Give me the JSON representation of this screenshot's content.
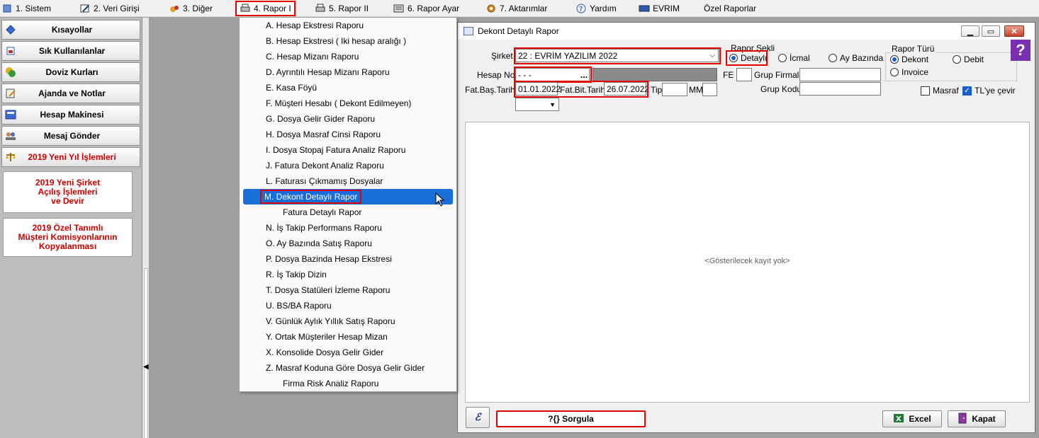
{
  "menubar": {
    "items": [
      {
        "label": "1.  Sistem",
        "icon": "system-icon"
      },
      {
        "label": "2.  Veri Girişi",
        "icon": "data-entry-icon"
      },
      {
        "label": "3.  Diğer",
        "icon": "other-icon"
      },
      {
        "label": "4.  Rapor I",
        "icon": "printer-icon"
      },
      {
        "label": "5.   Rapor II",
        "icon": "printer-icon"
      },
      {
        "label": "6.   Rapor Ayar",
        "icon": "report-settings-icon"
      },
      {
        "label": "7.  Aktarımlar",
        "icon": "transfer-icon"
      },
      {
        "label": "Yardım",
        "icon": "help-icon"
      },
      {
        "label": "EVRIM",
        "icon": "evrim-icon"
      },
      {
        "label": "Özel Raporlar",
        "icon": ""
      }
    ]
  },
  "sidebar": {
    "buttons": [
      {
        "label": "Kısayollar"
      },
      {
        "label": "Sık Kullanılanlar"
      },
      {
        "label": "Doviz Kurları"
      },
      {
        "label": "Ajanda ve Notlar"
      },
      {
        "label": "Hesap Makinesi"
      },
      {
        "label": "Mesaj Gönder"
      },
      {
        "label": "2019 Yeni Yıl İşlemleri"
      }
    ],
    "big_buttons": [
      {
        "label": "2019 Yeni Şirket\nAçılış İşlemleri\nve Devir"
      },
      {
        "label": "2019 Özel Tanımlı\nMüşteri Komisyonlarının\nKopyalanması"
      }
    ]
  },
  "dropdown": {
    "items": [
      "A.  Hesap Ekstresi Raporu",
      "B.  Hesap Ekstresi ( Iki hesap aralığı )",
      "C.  Hesap Mizanı Raporu",
      "D.  Ayrıntılı Hesap Mizanı Raporu",
      "E.  Kasa Föyü",
      "F.  Müşteri Hesabı ( Dekont Edilmeyen)",
      "G.  Dosya Gelir Gider Raporu",
      "H.  Dosya Masraf Cinsi Raporu",
      "I.  Dosya Stopaj Fatura Analiz Raporu",
      "J.  Fatura Dekont Analiz Raporu",
      "L.  Faturası Çıkmamış Dosyalar",
      "M.  Dekont Detaylı Rapor",
      "Fatura Detaylı Rapor",
      "N.  İş Takip Performans Raporu",
      "O.  Ay Bazında Satış Raporu",
      "P.  Dosya Bazinda Hesap Ekstresi",
      "R.  İş Takip Dizin",
      "T.  Dosya Statüleri İzleme Raporu",
      "U.  BS/BA Raporu",
      "V. Günlük Aylık Yıllık Satış Raporu",
      "Y. Ortak Müşteriler Hesap Mizan",
      "X. Konsolide Dosya Gelir Gider",
      "Z. Masraf Koduna Göre Dosya Gelir Gider",
      "Firma Risk Analiz Raporu"
    ],
    "selected_index": 11
  },
  "dialog": {
    "title": "Dekont Detaylı Rapor",
    "sirket_label": "Şirket",
    "sirket_value": "22 : EVRİM YAZILIM  2022",
    "hesap_no_label": "Hesap No",
    "hesap_no_value": "-  -  -",
    "ellipsis": "...",
    "fat_bas_label": "Fat.Baş.Tarihi",
    "fat_bas_value": "01.01.2022",
    "fat_bit_label": "Fat.Bit.Tarihi",
    "fat_bit_value": "26.07.2022",
    "tip_label": "Tip",
    "mm_label": "MM",
    "fe_label": "FE",
    "grup_firmalar_label": "Grup Firmaları",
    "grup_kodu_label": "Grup Kodu",
    "rapor_sekli_title": "Rapor Şekli",
    "rapor_sekli_options": [
      "Detaylı",
      "İcmal",
      "Ay Bazında"
    ],
    "rapor_turu_title": "Rapor Türü",
    "rapor_turu_options": [
      "Dekont",
      "Debit",
      "Invoice"
    ],
    "masraf_label": "Masraf",
    "tl_cevir_label": "TL'ye çevir",
    "empty_text": "<Gösterilecek kayıt yok>",
    "sorgula_label": "?{} Sorgula",
    "excel_label": "Excel",
    "kapat_label": "Kapat",
    "help_glyph": "?"
  },
  "colors": {
    "highlight": "#1a6ed8",
    "annotation": "#e00000",
    "sidebar_red": "#cc0000"
  }
}
